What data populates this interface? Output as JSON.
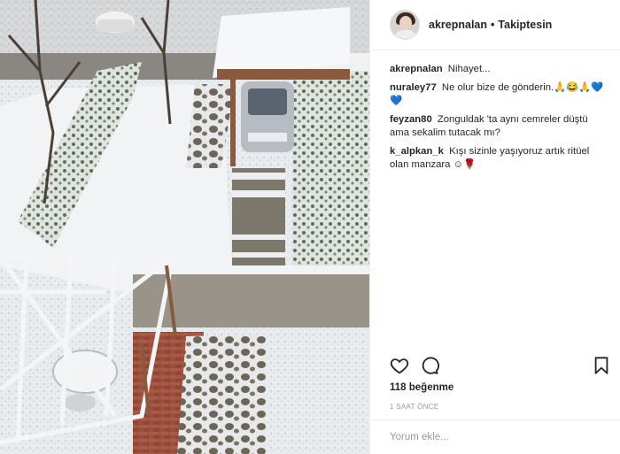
{
  "post": {
    "username": "akrepnalan",
    "separator": "•",
    "follow_status": "Takiptesin",
    "likes": "118 beğenme",
    "time": "1 SAAT ÖNCE",
    "comment_placeholder": "Yorum ekle..."
  },
  "comments": [
    {
      "user": "akrepnalan",
      "text": "Nihayet..."
    },
    {
      "user": "nuraley77",
      "text": "Ne olur bize de gönderin.🙏😂🙏💙💙"
    },
    {
      "user": "feyzan80",
      "text": "Zonguldak 'ta aynı cemreler düştü ama sekalim tutacak mı?"
    },
    {
      "user": "k_alpkan_k",
      "text": "Kışı sizinle yaşıyoruz artık ritüel olan manzara ☺🌹"
    }
  ],
  "icons": {
    "like": "heart-icon",
    "comment": "comment-bubble-icon",
    "save": "bookmark-icon"
  },
  "colors": {
    "text": "#262626",
    "muted": "#999999",
    "border": "#efefef"
  }
}
